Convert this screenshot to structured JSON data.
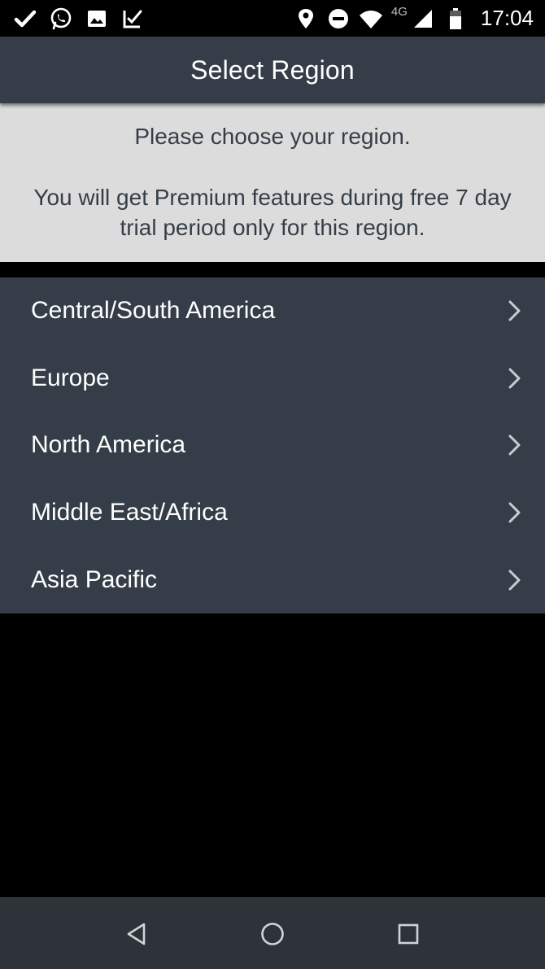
{
  "status_bar": {
    "network_label": "4G",
    "time": "17:04",
    "icons": [
      "check-icon",
      "whatsapp-icon",
      "image-icon",
      "delivery-icon",
      "location-icon",
      "do-not-disturb-icon",
      "wifi-icon",
      "signal-icon",
      "battery-icon"
    ]
  },
  "header": {
    "title": "Select Region"
  },
  "info": {
    "line1": "Please choose your region.",
    "line2": "You will get Premium features during free 7 day trial period only for this region."
  },
  "regions": [
    {
      "label": "Central/South America"
    },
    {
      "label": "Europe"
    },
    {
      "label": "North America"
    },
    {
      "label": "Middle East/Africa"
    },
    {
      "label": "Asia Pacific"
    }
  ],
  "navigation": {
    "buttons": [
      "back-icon",
      "home-icon",
      "recent-apps-icon"
    ]
  },
  "colors": {
    "header_bg": "#353e48",
    "info_bg": "#dcdcdc",
    "list_bg": "#353e48",
    "nav_bg": "#2e3339",
    "text_light": "#ffffff",
    "text_dark": "#353e48"
  }
}
